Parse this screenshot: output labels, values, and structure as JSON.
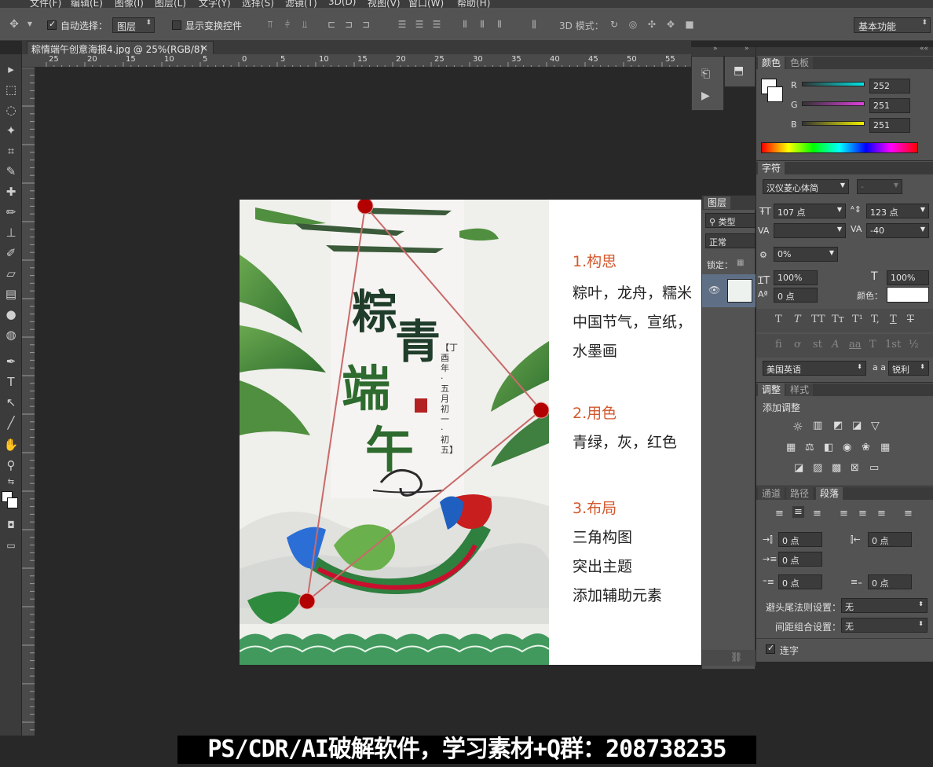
{
  "menubar": {
    "items": [
      "文件(F)",
      "编辑(E)",
      "图像(I)",
      "图层(L)",
      "文字(Y)",
      "选择(S)",
      "滤镜(T)",
      "3D(D)",
      "视图(V)",
      "窗口(W)",
      "帮助(H)"
    ]
  },
  "options": {
    "auto_select_label": "自动选择：",
    "auto_select_checked": true,
    "auto_select_target": "图层",
    "show_transform_label": "显示变换控件",
    "show_transform_checked": false,
    "mode3d_label": "3D 模式：",
    "workspace": "基本功能"
  },
  "document_tab": {
    "title": "粽情端午创意海报4.jpg @ 25%(RGB/8)",
    "close": "×"
  },
  "ruler_top_ticks": [
    "25",
    "20",
    "15",
    "10",
    "5",
    "0",
    "5",
    "10",
    "15",
    "20",
    "25",
    "30",
    "35",
    "40",
    "45",
    "50",
    "55"
  ],
  "canvas": {
    "poster_title_chars": [
      "粽",
      "青",
      "端",
      "午"
    ],
    "poster_date": "【丁酉年·五月初一·初五】",
    "sections": [
      {
        "heading": "1.构思",
        "lines": [
          "粽叶，龙舟，糯米",
          "中国节气，宣纸，",
          "水墨画"
        ]
      },
      {
        "heading": "2.用色",
        "lines": [
          "青绿，灰，红色"
        ]
      },
      {
        "heading": "3.布局",
        "lines": [
          "三角构图",
          "突出主题",
          "添加辅助元素"
        ]
      }
    ]
  },
  "layers_panel": {
    "tab": "图层",
    "filter_label": "类型",
    "blend_mode": "正常",
    "lock_label": "锁定："
  },
  "color_panel": {
    "tabs": [
      "颜色",
      "色板"
    ],
    "channels": [
      {
        "name": "R",
        "value": "252",
        "color": "#00e5e5"
      },
      {
        "name": "G",
        "value": "251",
        "color": "#e040e0"
      },
      {
        "name": "B",
        "value": "251",
        "color": "#f0f000"
      }
    ]
  },
  "character_panel": {
    "tab": "字符",
    "font_family": "汉仪菱心体简",
    "font_style": "-",
    "font_size": "107 点",
    "leading": "123 点",
    "kerning": "",
    "tracking": "-40",
    "scale_pct": "0%",
    "vertical_scale": "100%",
    "horizontal_scale": "100%",
    "baseline_shift": "0 点",
    "color_label": "颜色：",
    "style_buttons": [
      "T",
      "T",
      "TT",
      "Tт",
      "T¹",
      "T,",
      "T",
      "T"
    ],
    "opentype_buttons": [
      "fi",
      "ơ",
      "st",
      "A",
      "aa",
      "T",
      "1st",
      "½"
    ],
    "language": "美国英语",
    "aa_label": "a a",
    "antialias": "锐利"
  },
  "adjustments_panel": {
    "tabs": [
      "调整",
      "样式"
    ],
    "add_label": "添加调整"
  },
  "paragraph_panel": {
    "tabs": [
      "通道",
      "路径",
      "段落"
    ],
    "indent_left": "0 点",
    "indent_right": "0 点",
    "indent_first": "0 点",
    "space_before": "0 点",
    "space_after": "0 点",
    "kinsoku_label": "避头尾法则设置：",
    "kinsoku_value": "无",
    "mojikumi_label": "间距组合设置：",
    "mojikumi_value": "无",
    "hyphenate_label": "连字",
    "hyphenate_checked": true
  },
  "banner": {
    "text": "PS/CDR/AI破解软件，学习素材+Q群：208738235"
  },
  "colors": {
    "accent_heading": "#d4582e",
    "triangle_line": "#c96a6a",
    "triangle_dot": "#b30000"
  }
}
